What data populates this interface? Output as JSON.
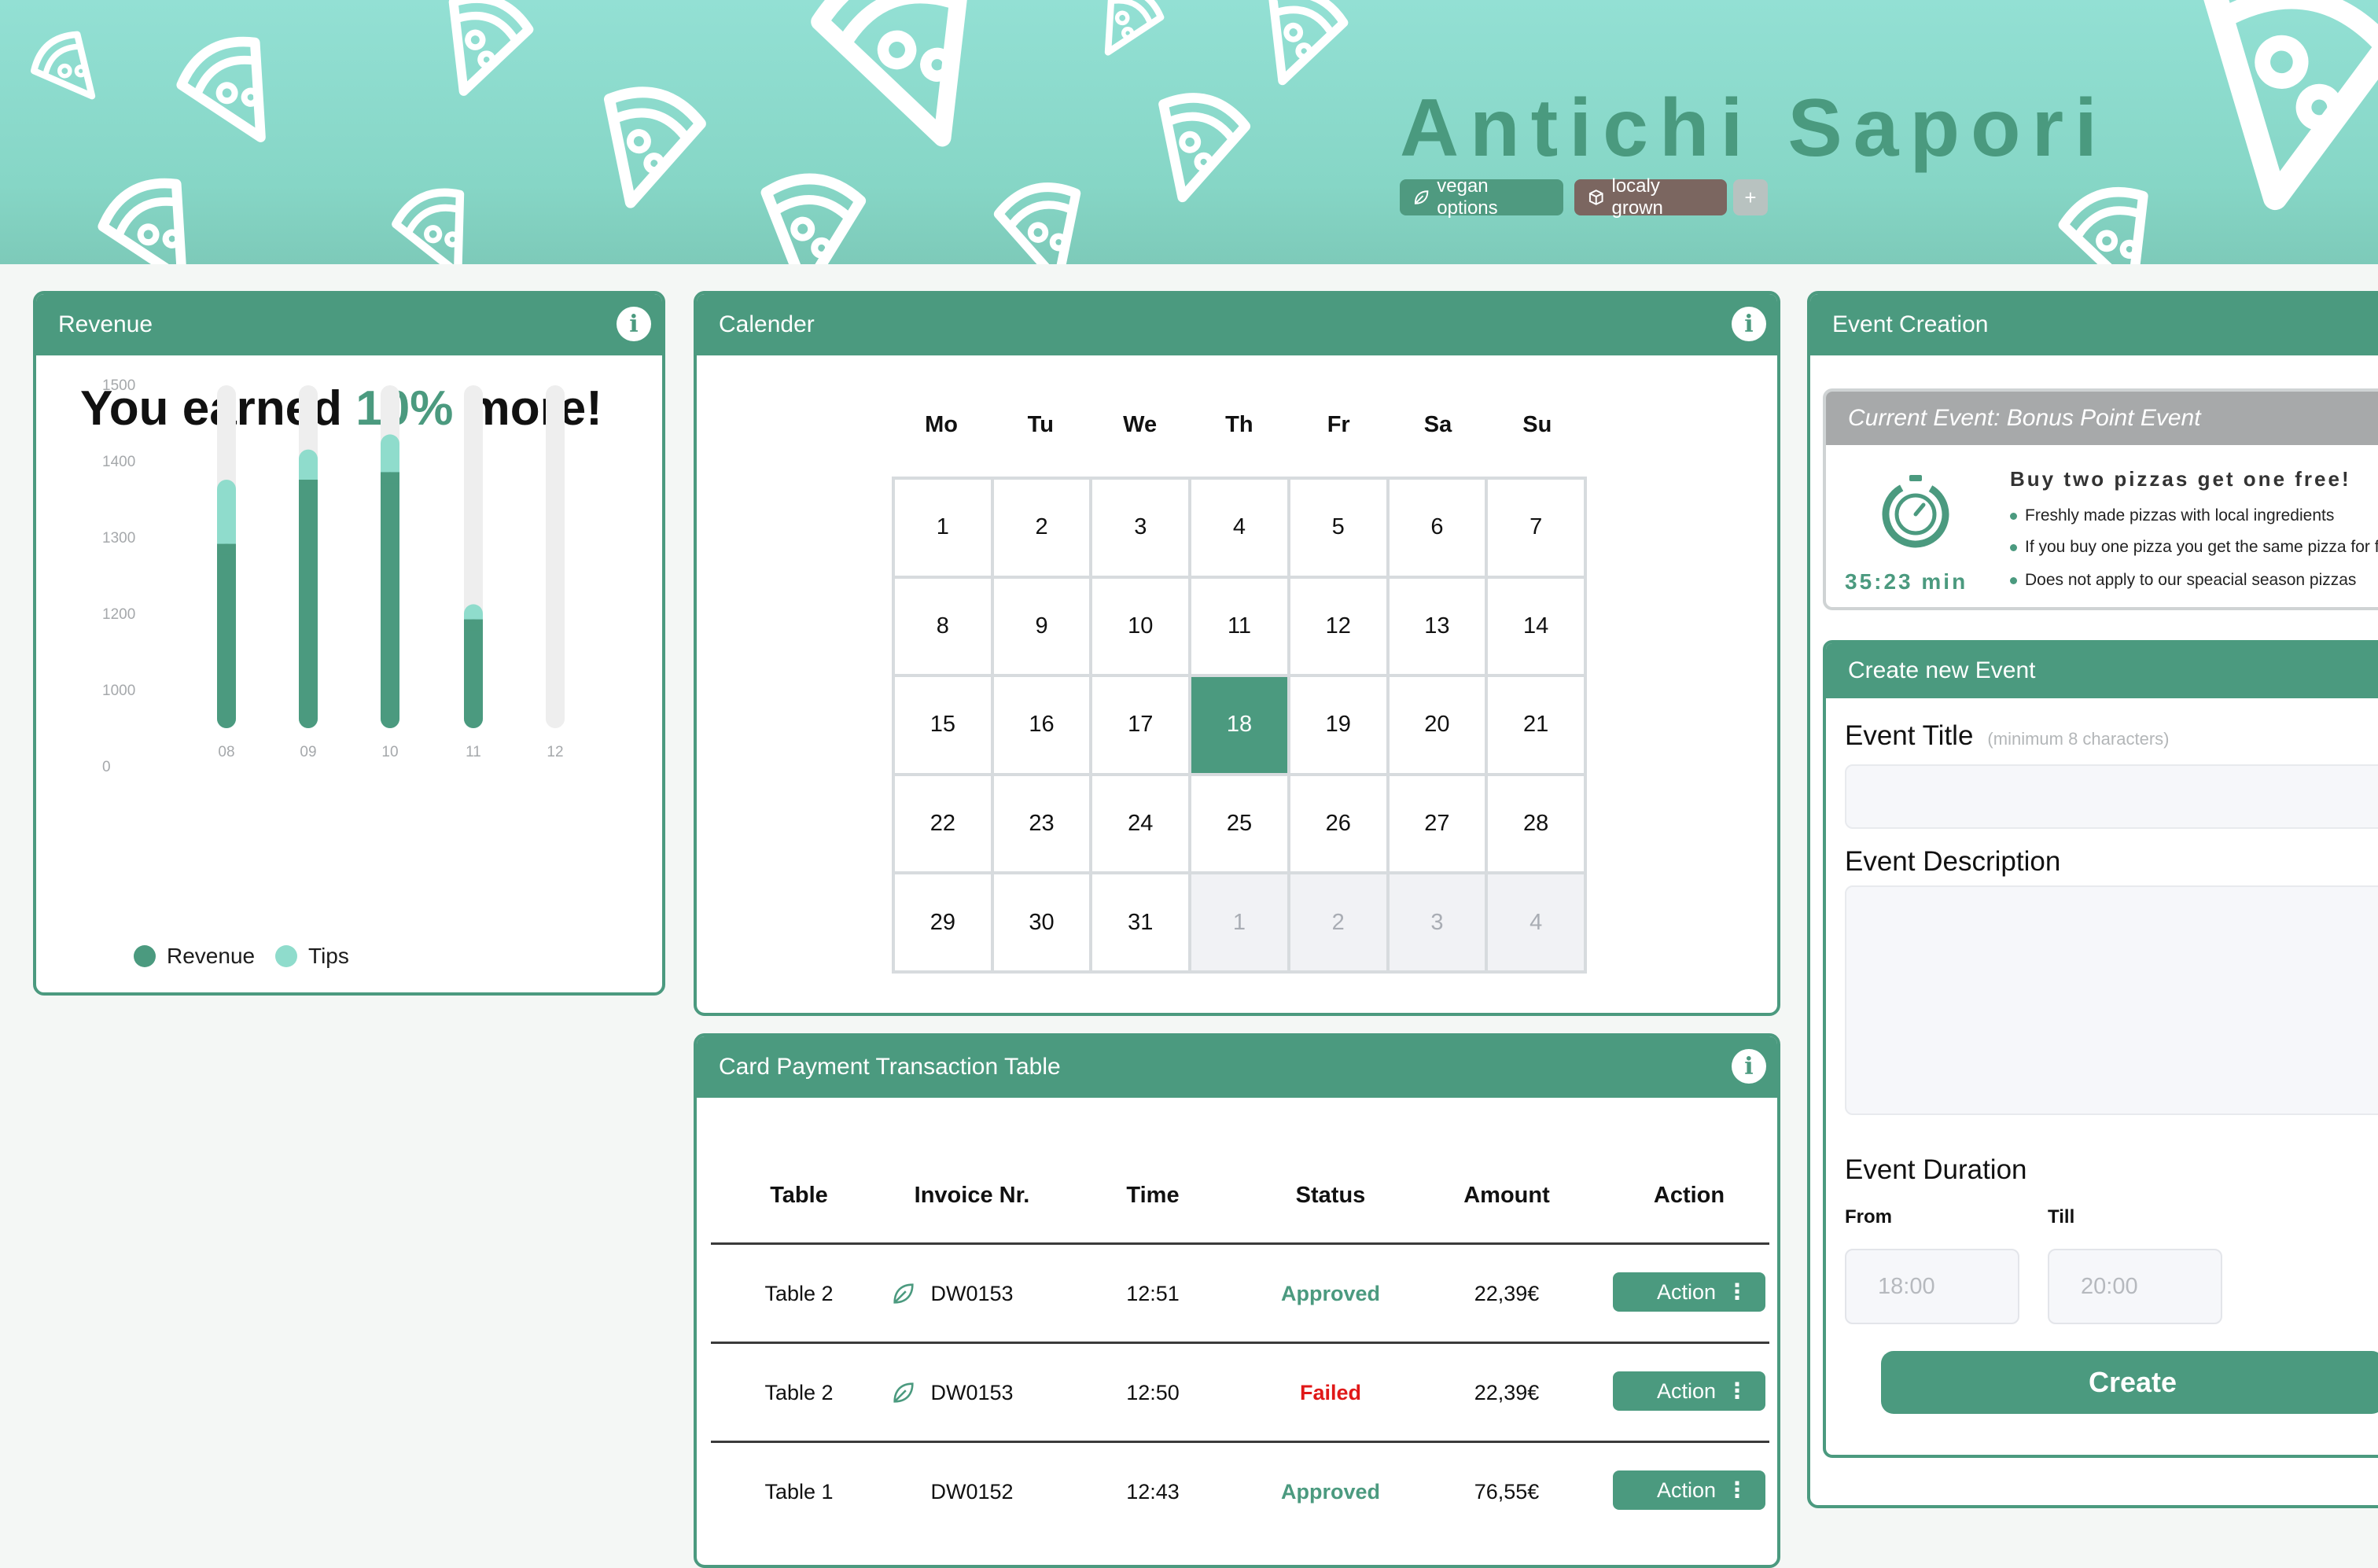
{
  "header": {
    "brand": "Antichi Sapori",
    "tags": [
      {
        "label": "vegan options",
        "icon": "leaf-icon"
      },
      {
        "label": "localy grown",
        "icon": "box-icon"
      },
      {
        "label": "+"
      }
    ]
  },
  "revenue": {
    "title": "Revenue",
    "headline_pre": "You earned ",
    "headline_highlight": "10%",
    "headline_post": " more!",
    "legend": [
      {
        "label": "Revenue",
        "color": "#4b9a7f"
      },
      {
        "label": "Tips",
        "color": "#8fdccc"
      }
    ]
  },
  "chart_data": {
    "type": "bar",
    "stacked": true,
    "categories": [
      "08",
      "09",
      "10",
      "11",
      "12"
    ],
    "y_ticks": [
      "1500",
      "1400",
      "1300",
      "1200",
      "1000",
      "0"
    ],
    "series": [
      {
        "name": "Revenue",
        "values": [
          1290,
          1375,
          1385,
          1180,
          0
        ],
        "color": "#4b9a7f"
      },
      {
        "name": "Tips",
        "values": [
          85,
          40,
          50,
          30,
          0
        ],
        "color": "#8fdccc"
      }
    ],
    "legend_position": "bottom-left",
    "track_color": "#eeeeee"
  },
  "calendar": {
    "title": "Calender",
    "weekdays": [
      "Mo",
      "Tu",
      "We",
      "Th",
      "Fr",
      "Sa",
      "Su"
    ],
    "days": [
      {
        "d": "1"
      },
      {
        "d": "2"
      },
      {
        "d": "3"
      },
      {
        "d": "4"
      },
      {
        "d": "5"
      },
      {
        "d": "6"
      },
      {
        "d": "7"
      },
      {
        "d": "8"
      },
      {
        "d": "9"
      },
      {
        "d": "10"
      },
      {
        "d": "11"
      },
      {
        "d": "12"
      },
      {
        "d": "13"
      },
      {
        "d": "14"
      },
      {
        "d": "15"
      },
      {
        "d": "16"
      },
      {
        "d": "17"
      },
      {
        "d": "18",
        "today": true
      },
      {
        "d": "19"
      },
      {
        "d": "20"
      },
      {
        "d": "21"
      },
      {
        "d": "22"
      },
      {
        "d": "23"
      },
      {
        "d": "24"
      },
      {
        "d": "25"
      },
      {
        "d": "26"
      },
      {
        "d": "27"
      },
      {
        "d": "28"
      },
      {
        "d": "29"
      },
      {
        "d": "30"
      },
      {
        "d": "31"
      },
      {
        "d": "1",
        "other": true
      },
      {
        "d": "2",
        "other": true
      },
      {
        "d": "3",
        "other": true
      },
      {
        "d": "4",
        "other": true
      }
    ]
  },
  "transactions": {
    "title": "Card Payment Transaction Table",
    "columns": [
      "Table",
      "Invoice Nr.",
      "Time",
      "Status",
      "Amount",
      "Action"
    ],
    "rows": [
      {
        "table": "Table 2",
        "invoice": "DW0153",
        "leaf": true,
        "time": "12:51",
        "status": "Approved",
        "amount": "22,39€",
        "action": "Action"
      },
      {
        "table": "Table 2",
        "invoice": "DW0153",
        "leaf": true,
        "time": "12:50",
        "status": "Failed",
        "amount": "22,39€",
        "action": "Action"
      },
      {
        "table": "Table 1",
        "invoice": "DW0152",
        "leaf": false,
        "time": "12:43",
        "status": "Approved",
        "amount": "76,55€",
        "action": "Action"
      }
    ]
  },
  "event": {
    "title": "Event Creation",
    "current": {
      "heading": "Current Event: Bonus Point Event",
      "timer": "35:23 min",
      "promo_title": "Buy two pizzas get one free!",
      "bullets": [
        "Freshly made pizzas with local ingredients",
        "If you buy one pizza you get the same pizza for free",
        "Does not apply to our speacial season pizzas"
      ]
    },
    "create": {
      "heading": "Create new Event",
      "title_label": "Event Title",
      "title_hint": "(minimum 8 characters)",
      "title_value": "",
      "description_label": "Event Description",
      "description_value": "",
      "duration_label": "Event Duration",
      "from_label": "From",
      "till_label": "Till",
      "from_placeholder": "18:00",
      "till_placeholder": "20:00",
      "create_button": "Create"
    }
  },
  "colors": {
    "accent": "#4b9a7f",
    "header_bg": "#93e0d4",
    "failed": "#e01818"
  }
}
